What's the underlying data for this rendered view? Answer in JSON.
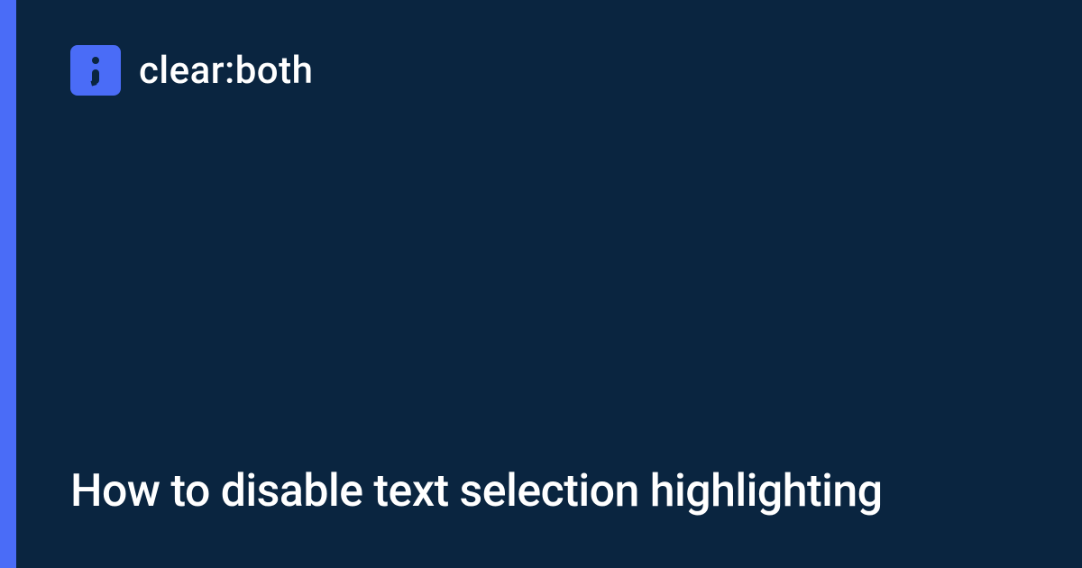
{
  "brand": {
    "name": "clear:both"
  },
  "page": {
    "title": "How to disable text selection highlighting"
  },
  "colors": {
    "accent": "#4a6cf7",
    "background": "#0a2540"
  }
}
